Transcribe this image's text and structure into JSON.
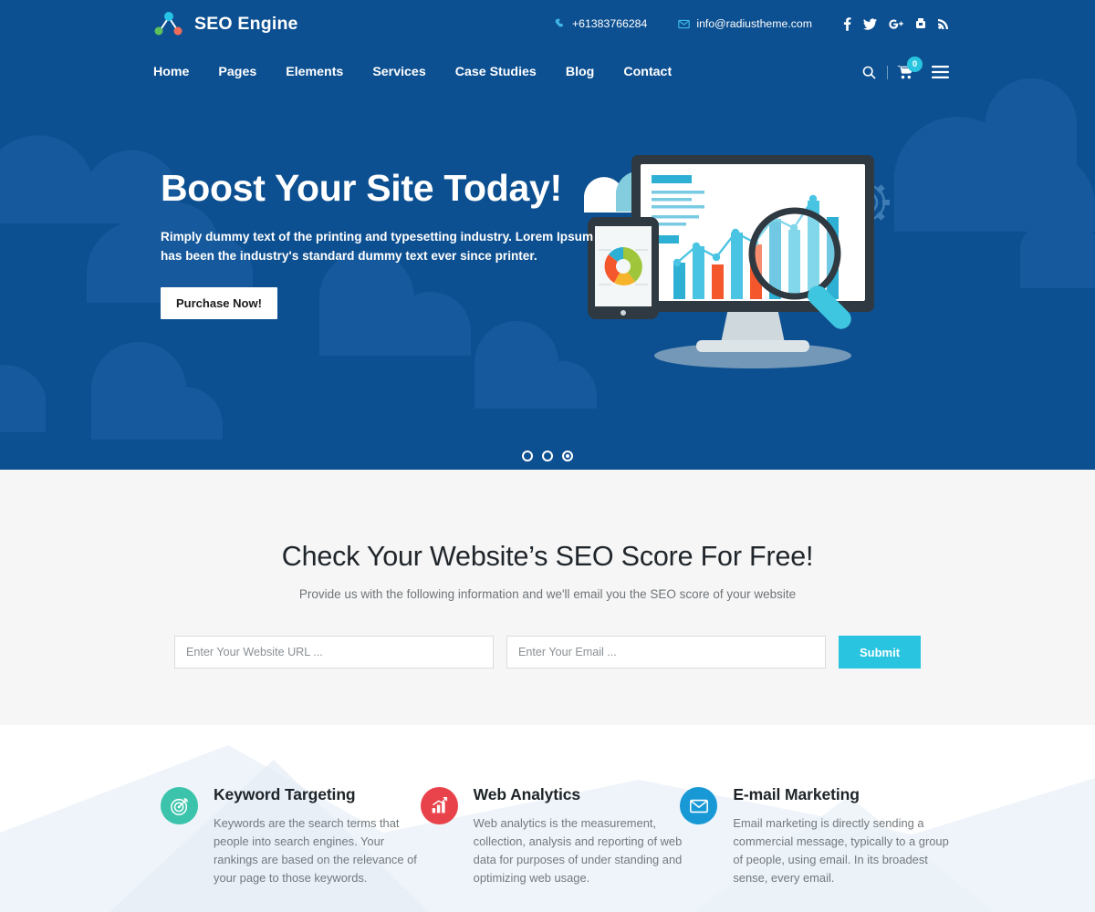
{
  "brand": {
    "name": "SEO Engine",
    "logo_icon": "network-nodes-icon"
  },
  "topbar": {
    "phone": {
      "icon": "phone-icon",
      "text": "+61383766284"
    },
    "email": {
      "icon": "envelope-icon",
      "text": "info@radiustheme.com"
    },
    "socials": [
      {
        "name": "facebook-icon",
        "glyph": "f"
      },
      {
        "name": "twitter-icon",
        "glyph": "t"
      },
      {
        "name": "google-plus-icon",
        "glyph": "G+"
      },
      {
        "name": "youtube-icon",
        "glyph": "yt"
      },
      {
        "name": "rss-icon",
        "glyph": "rss"
      }
    ]
  },
  "nav": {
    "items": [
      {
        "label": "Home"
      },
      {
        "label": "Pages"
      },
      {
        "label": "Elements"
      },
      {
        "label": "Services"
      },
      {
        "label": "Case Studies"
      },
      {
        "label": "Blog"
      },
      {
        "label": "Contact"
      }
    ],
    "tools": {
      "search_icon": "search-icon",
      "cart_icon": "cart-icon",
      "cart_count": "0",
      "menu_icon": "hamburger-menu-icon"
    }
  },
  "hero": {
    "title": "Boost Your Site Today!",
    "subtitle": "Rimply dummy text of the printing and typesetting industry. Lorem Ipsum has been the industry's standard dummy text ever since printer.",
    "cta_label": "Purchase Now!",
    "illustration": "seo-analytics-desktop-tablet-magnifier-illustration",
    "slider_dots": 3,
    "active_dot": 3
  },
  "seo_section": {
    "title": "Check Your Website’s SEO Score For Free!",
    "subtitle": "Provide us with the following information and we'll email you the SEO score of your website",
    "url_placeholder": "Enter Your Website URL ...",
    "url_value": "",
    "email_placeholder": "Enter Your Email ...",
    "email_value": "",
    "submit_label": "Submit"
  },
  "services": [
    {
      "icon": "target-bullseye-icon",
      "icon_color": "#3bc4ab",
      "title": "Keyword Targeting",
      "text": "Keywords are the search terms that people into search engines. Your rankings are based on the relevance of your page to those keywords."
    },
    {
      "icon": "bar-chart-growth-icon",
      "icon_color": "#e8434a",
      "title": "Web Analytics",
      "text": "Web analytics is the measurement, collection, analysis and reporting of web data for purposes of under standing and optimizing web usage."
    },
    {
      "icon": "envelope-icon",
      "icon_color": "#1899d6",
      "title": "E-mail Marketing",
      "text": "Email marketing is directly sending a commercial message, typically to a group of people, using email. In its broadest sense, every email."
    }
  ],
  "colors": {
    "hero_blue": "#0d5091",
    "cloud_blue": "#16599c",
    "accent_cyan": "#29c5e0",
    "section_gray": "#f6f6f6"
  }
}
